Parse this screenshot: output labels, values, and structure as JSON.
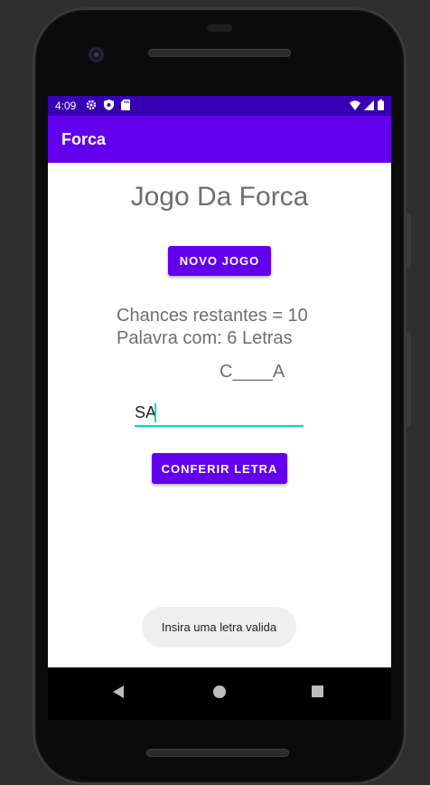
{
  "status_bar": {
    "time": "4:09",
    "left_icons": [
      "gear-icon",
      "shield-icon",
      "sd-card-icon"
    ],
    "right_icons": [
      "wifi-icon",
      "signal-icon",
      "battery-icon"
    ],
    "color": "#3700b3"
  },
  "app_bar": {
    "title": "Forca",
    "color": "#6200ee"
  },
  "main": {
    "game_title": "Jogo Da Forca",
    "new_game_button": "NOVO JOGO",
    "chances_text": "Chances restantes = 10",
    "word_length_text": "Palavra com: 6 Letras",
    "word_display": "C____A",
    "letter_input_value": "SA",
    "check_button": "CONFERIR LETRA"
  },
  "toast": {
    "message": "Insira uma letra valida"
  },
  "nav_bar": {
    "buttons": [
      "back-icon",
      "home-icon",
      "recents-icon"
    ]
  },
  "colors": {
    "primary": "#6200ee",
    "primary_dark": "#3700b3",
    "accent": "#03dac5"
  }
}
